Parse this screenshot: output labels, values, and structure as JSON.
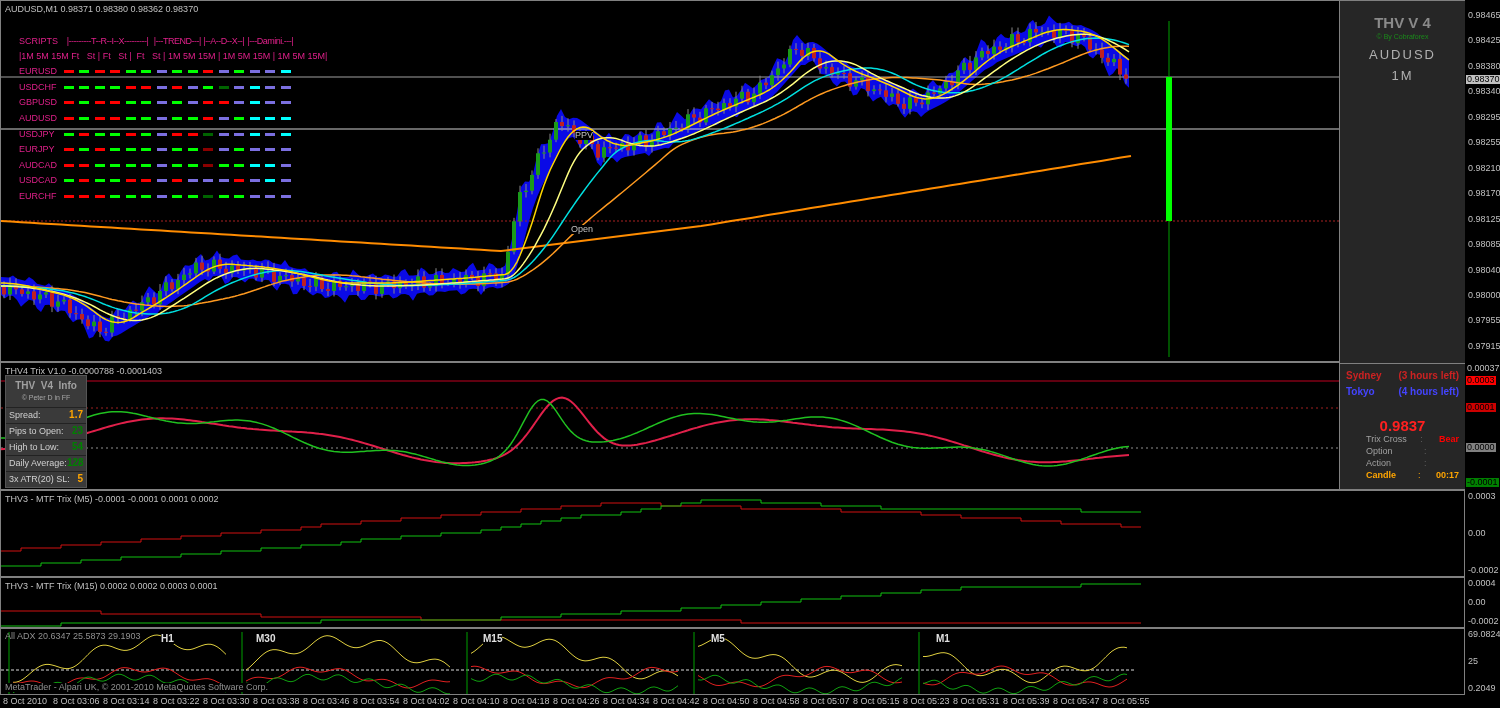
{
  "main_chart": {
    "title": "AUDUSD,M1  0.98371 0.98380 0.98362 0.98370",
    "labels": [
      "PPV",
      "Open"
    ],
    "price_axis": [
      "0.98465",
      "0.98425",
      "0.98380",
      "0.98340",
      "0.98295",
      "0.98255",
      "0.98210",
      "0.98170",
      "0.98125",
      "0.98085",
      "0.98040",
      "0.98000",
      "0.97955",
      "0.97915"
    ],
    "current_price": "0.98370"
  },
  "scripts": {
    "title": "SCRIPTS",
    "groups": [
      "|---------T--R--I--X---------|",
      "|---TREND---|",
      "|--A--D--X--|",
      "|---Damini.---|"
    ],
    "subheader": "|1M 5M 15M Ft   St | Ft   St |  Ft   St | 1M 5M 15M | 1M 5M 15M | 1M 5M 15M|",
    "rows": [
      {
        "pair": "EURUSD",
        "cells": [
          {
            "color": "#ff0000"
          },
          {
            "color": "#00ff00"
          },
          {
            "color": "#ff0000"
          },
          {
            "color": "#ff0000"
          },
          {
            "color": "#00ff00"
          },
          {
            "color": "#00ff00"
          },
          {
            "color": "#7b6fe0"
          },
          {
            "color": "#00ff00"
          },
          {
            "color": "#00ff00"
          },
          {
            "color": "#ff0000"
          },
          {
            "color": "#7b6fe0"
          },
          {
            "color": "#00ff00"
          },
          {
            "color": "#7b6fe0"
          },
          {
            "color": "#7b6fe0"
          },
          {
            "color": "#00ffff"
          }
        ]
      },
      {
        "pair": "USDCHF",
        "cells": [
          {
            "color": "#00ff00"
          },
          {
            "color": "#00ff00"
          },
          {
            "color": "#00ff00"
          },
          {
            "color": "#00ff00"
          },
          {
            "color": "#ff0000"
          },
          {
            "color": "#ff0000"
          },
          {
            "color": "#7b6fe0"
          },
          {
            "color": "#ff0000"
          },
          {
            "color": "#7b6fe0"
          },
          {
            "color": "#00ff00"
          },
          {
            "color": "#006400"
          },
          {
            "color": "#7b6fe0"
          },
          {
            "color": "#00ffff"
          },
          {
            "color": "#7b6fe0"
          },
          {
            "color": "#7b6fe0"
          }
        ]
      },
      {
        "pair": "GBPUSD",
        "cells": [
          {
            "color": "#ff0000"
          },
          {
            "color": "#00ff00"
          },
          {
            "color": "#ff0000"
          },
          {
            "color": "#ff0000"
          },
          {
            "color": "#00ff00"
          },
          {
            "color": "#00ff00"
          },
          {
            "color": "#7b6fe0"
          },
          {
            "color": "#00ff00"
          },
          {
            "color": "#7b6fe0"
          },
          {
            "color": "#ff0000"
          },
          {
            "color": "#ff0000"
          },
          {
            "color": "#7b6fe0"
          },
          {
            "color": "#00ffff"
          },
          {
            "color": "#7b6fe0"
          },
          {
            "color": "#7b6fe0"
          }
        ]
      },
      {
        "pair": "AUDUSD",
        "cells": [
          {
            "color": "#ff0000"
          },
          {
            "color": "#00ff00"
          },
          {
            "color": "#ff0000"
          },
          {
            "color": "#ff0000"
          },
          {
            "color": "#00ff00"
          },
          {
            "color": "#00ff00"
          },
          {
            "color": "#7b6fe0"
          },
          {
            "color": "#00ff00"
          },
          {
            "color": "#00ff00"
          },
          {
            "color": "#ff0000"
          },
          {
            "color": "#7b6fe0"
          },
          {
            "color": "#00ff00"
          },
          {
            "color": "#00ffff"
          },
          {
            "color": "#00ffff"
          },
          {
            "color": "#00ffff"
          }
        ]
      },
      {
        "pair": "USDJPY",
        "cells": [
          {
            "color": "#00ff00"
          },
          {
            "color": "#ff0000"
          },
          {
            "color": "#00ff00"
          },
          {
            "color": "#00ff00"
          },
          {
            "color": "#ff0000"
          },
          {
            "color": "#00ff00"
          },
          {
            "color": "#7b6fe0"
          },
          {
            "color": "#ff0000"
          },
          {
            "color": "#ff0000"
          },
          {
            "color": "#006400"
          },
          {
            "color": "#7b6fe0"
          },
          {
            "color": "#7b6fe0"
          },
          {
            "color": "#00ffff"
          },
          {
            "color": "#7b6fe0"
          },
          {
            "color": "#00ffff"
          }
        ]
      },
      {
        "pair": "EURJPY",
        "cells": [
          {
            "color": "#ff0000"
          },
          {
            "color": "#00ff00"
          },
          {
            "color": "#ff0000"
          },
          {
            "color": "#00ff00"
          },
          {
            "color": "#00ff00"
          },
          {
            "color": "#00ff00"
          },
          {
            "color": "#7b6fe0"
          },
          {
            "color": "#00ff00"
          },
          {
            "color": "#00ff00"
          },
          {
            "color": "#8b0000"
          },
          {
            "color": "#7b6fe0"
          },
          {
            "color": "#00ff00"
          },
          {
            "color": "#7b6fe0"
          },
          {
            "color": "#7b6fe0"
          },
          {
            "color": "#7b6fe0"
          }
        ]
      },
      {
        "pair": "AUDCAD",
        "cells": [
          {
            "color": "#ff0000"
          },
          {
            "color": "#ff0000"
          },
          {
            "color": "#00ff00"
          },
          {
            "color": "#00ff00"
          },
          {
            "color": "#00ff00"
          },
          {
            "color": "#00ff00"
          },
          {
            "color": "#7b6fe0"
          },
          {
            "color": "#00ff00"
          },
          {
            "color": "#00ff00"
          },
          {
            "color": "#8b0000"
          },
          {
            "color": "#00ff00"
          },
          {
            "color": "#00ff00"
          },
          {
            "color": "#00ffff"
          },
          {
            "color": "#00ffff"
          },
          {
            "color": "#7b6fe0"
          }
        ]
      },
      {
        "pair": "USDCAD",
        "cells": [
          {
            "color": "#00ff00"
          },
          {
            "color": "#ff0000"
          },
          {
            "color": "#00ff00"
          },
          {
            "color": "#00ff00"
          },
          {
            "color": "#ff0000"
          },
          {
            "color": "#ff0000"
          },
          {
            "color": "#7b6fe0"
          },
          {
            "color": "#ff0000"
          },
          {
            "color": "#7b6fe0"
          },
          {
            "color": "#7b6fe0"
          },
          {
            "color": "#7b6fe0"
          },
          {
            "color": "#ff0000"
          },
          {
            "color": "#7b6fe0"
          },
          {
            "color": "#00ffff"
          },
          {
            "color": "#7b6fe0"
          }
        ]
      },
      {
        "pair": "EURCHF",
        "cells": [
          {
            "color": "#ff0000"
          },
          {
            "color": "#ff0000"
          },
          {
            "color": "#ff0000"
          },
          {
            "color": "#00ff00"
          },
          {
            "color": "#00ff00"
          },
          {
            "color": "#00ff00"
          },
          {
            "color": "#7b6fe0"
          },
          {
            "color": "#00ff00"
          },
          {
            "color": "#00ff00"
          },
          {
            "color": "#006400"
          },
          {
            "color": "#00ff00"
          },
          {
            "color": "#00ff00"
          },
          {
            "color": "#7b6fe0"
          },
          {
            "color": "#7b6fe0"
          },
          {
            "color": "#7b6fe0"
          }
        ]
      }
    ]
  },
  "brand_panel": {
    "title": "THV V 4",
    "credit": "© By Cobraforex",
    "symbol": "AUDUSD",
    "timeframe": "1M"
  },
  "trix": {
    "title": "THV4 Trix V1.0 -0.0000788 -0.0001403",
    "axis": [
      {
        "text": "0.00037",
        "color": "#000000"
      },
      {
        "text": "0.0003",
        "color": "#ff0000"
      },
      {
        "text": "0.0001",
        "color": "#cc0000"
      },
      {
        "text": "0.0000",
        "color": "#808080"
      },
      {
        "text": "-0.0001",
        "color": "#008000"
      }
    ]
  },
  "info_box": {
    "title": "THV  V4  Info",
    "credit": "© Peter D in FF",
    "rows": [
      {
        "label": "Spread:",
        "value": "1.7",
        "color": "#ffa500"
      },
      {
        "label": "Pips to Open:",
        "value": "23",
        "color": "#008000"
      },
      {
        "label": "High to Low:",
        "value": "54",
        "color": "#008000"
      },
      {
        "label": "Daily Average:",
        "value": "128",
        "color": "#008000"
      },
      {
        "label": "3x ATR(20) SL:",
        "value": "5",
        "color": "#ffa500"
      }
    ]
  },
  "sessions": [
    {
      "name": "Sydney",
      "remaining": "(3 hours left)",
      "color": "#cc2222"
    },
    {
      "name": "Tokyo",
      "remaining": "(4 hours left)",
      "color": "#4444ff"
    }
  ],
  "status": {
    "price": "0.9837",
    "rows": [
      {
        "label": "Trix Cross",
        "sep": ":",
        "value": "Bear",
        "color": "#ff0000",
        "highlight": false
      },
      {
        "label": "Option",
        "sep": ":",
        "highlight": false
      },
      {
        "label": "Action",
        "sep": ":",
        "highlight": false
      },
      {
        "label": "Candle",
        "sep": ":",
        "value": "00:17",
        "color": "#ffa500",
        "highlight": true
      }
    ]
  },
  "mtf_m5": {
    "title": "THV3 - MTF Trix (M5) -0.0001 -0.0001 0.0001 0.0002",
    "axis": [
      "0.0003",
      "0.00",
      "-0.0002"
    ]
  },
  "mtf_m15": {
    "title": "THV3 - MTF Trix (M15) 0.0002 0.0002 0.0003 0.0001",
    "axis": [
      "0.0004",
      "0.00",
      "-0.0002"
    ]
  },
  "adx": {
    "title": "All ADX 20.6347 25.5873 29.1903",
    "sections": [
      "H1",
      "M30",
      "M15",
      "M5",
      "M1"
    ],
    "axis": [
      "69.0824",
      "25",
      "0.2049"
    ],
    "copyright": "MetaTrader - Alpari UK, © 2001-2010 MetaQuotes Software Corp."
  },
  "time_axis": [
    "8 Oct 2010",
    "8 Oct 03:06",
    "8 Oct 03:14",
    "8 Oct 03:22",
    "8 Oct 03:30",
    "8 Oct 03:38",
    "8 Oct 03:46",
    "8 Oct 03:54",
    "8 Oct 04:02",
    "8 Oct 04:10",
    "8 Oct 04:18",
    "8 Oct 04:26",
    "8 Oct 04:34",
    "8 Oct 04:42",
    "8 Oct 04:50",
    "8 Oct 04:58",
    "8 Oct 05:07",
    "8 Oct 05:15",
    "8 Oct 05:23",
    "8 Oct 05:31",
    "8 Oct 05:39",
    "8 Oct 05:47",
    "8 Oct 05:55"
  ]
}
